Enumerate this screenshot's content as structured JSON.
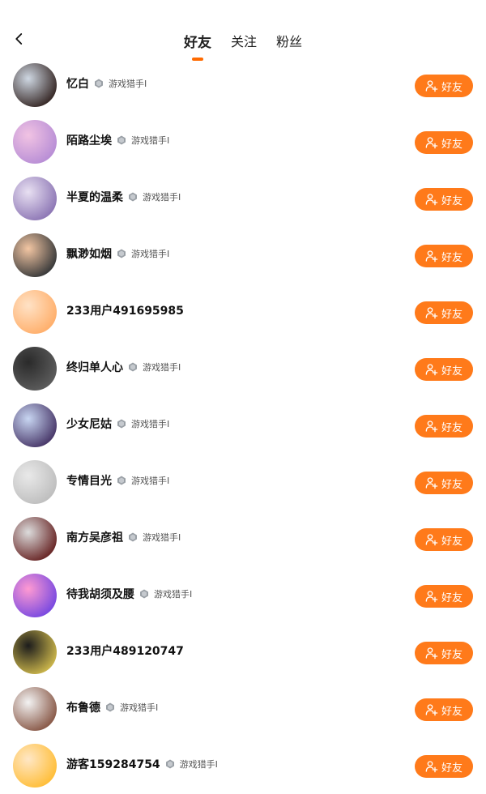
{
  "status": {
    "time": "",
    "right": ""
  },
  "header": {
    "tabs": [
      {
        "label": "好友",
        "active": true
      },
      {
        "label": "关注",
        "active": false
      },
      {
        "label": "粉丝",
        "active": false
      }
    ]
  },
  "accent": "#ff7a1a",
  "badge_text": "游戏猎手I",
  "button_label": "好友",
  "users": [
    {
      "name": "忆白",
      "badge": true,
      "avatar_colors": [
        "#cfd8e3",
        "#3a2c2a"
      ]
    },
    {
      "name": "陌路尘埃",
      "badge": true,
      "avatar_colors": [
        "#f1c3e3",
        "#b98fd6"
      ]
    },
    {
      "name": "半夏的温柔",
      "badge": true,
      "avatar_colors": [
        "#e8e0f2",
        "#8f79b6"
      ]
    },
    {
      "name": "飘渺如烟",
      "badge": true,
      "avatar_colors": [
        "#f3c6a3",
        "#3c3c3c"
      ]
    },
    {
      "name": "233用户491695985",
      "badge": false,
      "avatar_colors": [
        "#ffe2c6",
        "#ffb06d"
      ]
    },
    {
      "name": "终归单人心",
      "badge": true,
      "avatar_colors": [
        "#2a2a2a",
        "#5b5b5b"
      ]
    },
    {
      "name": "少女尼姑",
      "badge": true,
      "avatar_colors": [
        "#c8d6f2",
        "#4b3b6c"
      ]
    },
    {
      "name": "专情目光",
      "badge": true,
      "avatar_colors": [
        "#e9e9e9",
        "#bfbfbf"
      ]
    },
    {
      "name": "南方吴彦祖",
      "badge": true,
      "avatar_colors": [
        "#dcdcdc",
        "#6b2a2a"
      ]
    },
    {
      "name": "待我胡须及腰",
      "badge": true,
      "avatar_colors": [
        "#ff9ad2",
        "#7c4be0"
      ]
    },
    {
      "name": "233用户489120747",
      "badge": false,
      "avatar_colors": [
        "#1c1c1c",
        "#c7b24a"
      ]
    },
    {
      "name": "布鲁德",
      "badge": true,
      "avatar_colors": [
        "#f3f3f3",
        "#8b5c4b"
      ]
    },
    {
      "name": "游客159284754",
      "badge": true,
      "avatar_colors": [
        "#ffe7c6",
        "#ffbf3c"
      ]
    }
  ]
}
